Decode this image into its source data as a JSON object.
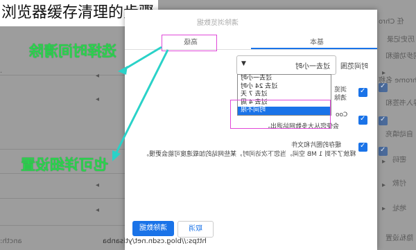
{
  "caption": "浏览器缓存清理的步骤",
  "annotations": {
    "choose_time": "选择时间清除",
    "detailed_settings": "也可详细设置",
    "arrow_color": "#2ad2c8",
    "text_color": "#2ad24d",
    "highlight_color": "#e048d8"
  },
  "background_settings": {
    "left_texts": [
      "ancth:"
    ],
    "right_texts": [
      "任 Chro",
      "历史记录",
      "同步功能和",
      "Chrome 名称",
      "导入书签和",
      "自动填充",
      "密码",
      "付款",
      "地址",
      "隐私设置"
    ]
  },
  "dialog": {
    "title": "清除浏览数据",
    "tabs": {
      "advanced": "高级",
      "basic": "基本"
    },
    "time_range": {
      "label": "时间范围",
      "selected": "过去一小时",
      "options": [
        "过去一小时",
        "过去 24 小时",
        "过去 7 天",
        "过去 4 周",
        "时间不限"
      ],
      "highlighted": "时间不限"
    },
    "options": [
      {
        "title": "浏览",
        "desc": "清除"
      },
      {
        "title": "Coo",
        "desc": "会使您从大多数网站退出。"
      },
      {
        "title": "缓存的图片和文件",
        "desc": "释放了不到 1 MB 空间。当您下次访问时，某些网站的加载速度可能会更慢。"
      }
    ],
    "buttons": {
      "cancel": "取消",
      "clear": "清除数据"
    }
  },
  "url_watermark": "https://blog.csdn.net/ytisanba"
}
